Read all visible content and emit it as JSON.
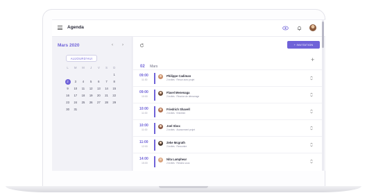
{
  "header": {
    "title": "Agenda",
    "icons": [
      "hamburger-icon",
      "eye-icon",
      "bell-icon",
      "avatar"
    ],
    "accent_color": "#6f62d8"
  },
  "sidebar": {
    "month": "Mars 2020",
    "today_label": "AUJOURD'HUI",
    "weekdays": [
      "L",
      "M",
      "M",
      "J",
      "V",
      "S",
      "D"
    ],
    "weeks": [
      [
        "",
        "",
        "",
        "",
        "",
        "",
        "1"
      ],
      [
        "2",
        "3",
        "4",
        "5",
        "6",
        "7",
        "8"
      ],
      [
        "9",
        "10",
        "11",
        "12",
        "13",
        "14",
        "15"
      ],
      [
        "16",
        "17",
        "18",
        "19",
        "20",
        "21",
        "22"
      ],
      [
        "23",
        "24",
        "25",
        "26",
        "27",
        "28",
        "29"
      ],
      [
        "30",
        "31",
        "",
        "",
        "",
        "",
        ""
      ]
    ],
    "selected_day": "2"
  },
  "main": {
    "invite_label": "+ INVITATION",
    "date_day": "02",
    "date_month": "Mars",
    "appointments": [
      {
        "time": "09:00",
        "end": "11:30",
        "name": "Philippe Cadiman",
        "sub": "2 invités · Revue avec projet",
        "avatar_color": "#c98f6b"
      },
      {
        "time": "09:00",
        "end": "10:00",
        "name": "Flavel Menenaga",
        "sub": "2 invités · Réunion de démarrage",
        "avatar_color": "#6b4d3a"
      },
      {
        "time": "10:00",
        "end": "11:00",
        "name": "Friedrich Shavell",
        "sub": "2 invités · Entretien",
        "avatar_color": "#b07050"
      },
      {
        "time": "10:00",
        "end": "11:00",
        "name": "Joel Sbox",
        "sub": "2 invités · Avancement projet",
        "avatar_color": "#8a5a48"
      },
      {
        "time": "11:00",
        "end": "12:00",
        "name": "Zeke Mcgrath",
        "sub": "2 invités · Rencontre",
        "avatar_color": "#4a3a30"
      },
      {
        "time": "14:00",
        "end": "15:00",
        "name": "Nita Lamphear",
        "sub": "2 invités · Rendez-vous",
        "avatar_color": "#d9a37e"
      }
    ]
  }
}
